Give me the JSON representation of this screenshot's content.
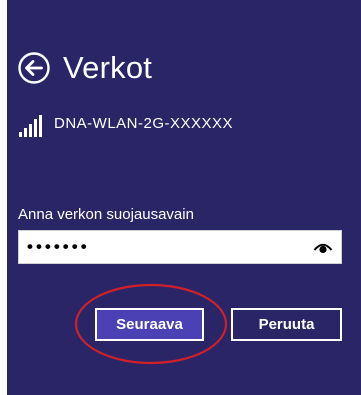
{
  "header": {
    "title": "Verkot",
    "back_icon": "back-arrow-circle-icon"
  },
  "network": {
    "ssid": "DNA-WLAN-2G-XXXXXX",
    "signal_icon": "wifi-signal-bars-icon"
  },
  "security": {
    "label": "Anna verkon suojausavain",
    "masked_value": "•••••••",
    "reveal_icon": "reveal-password-eye-icon"
  },
  "buttons": {
    "next_label": "Seuraava",
    "cancel_label": "Peruuta"
  },
  "colors": {
    "panel_background": "#2a2566",
    "primary_button": "#4a41b5",
    "highlight_annotation": "#d0202a"
  }
}
